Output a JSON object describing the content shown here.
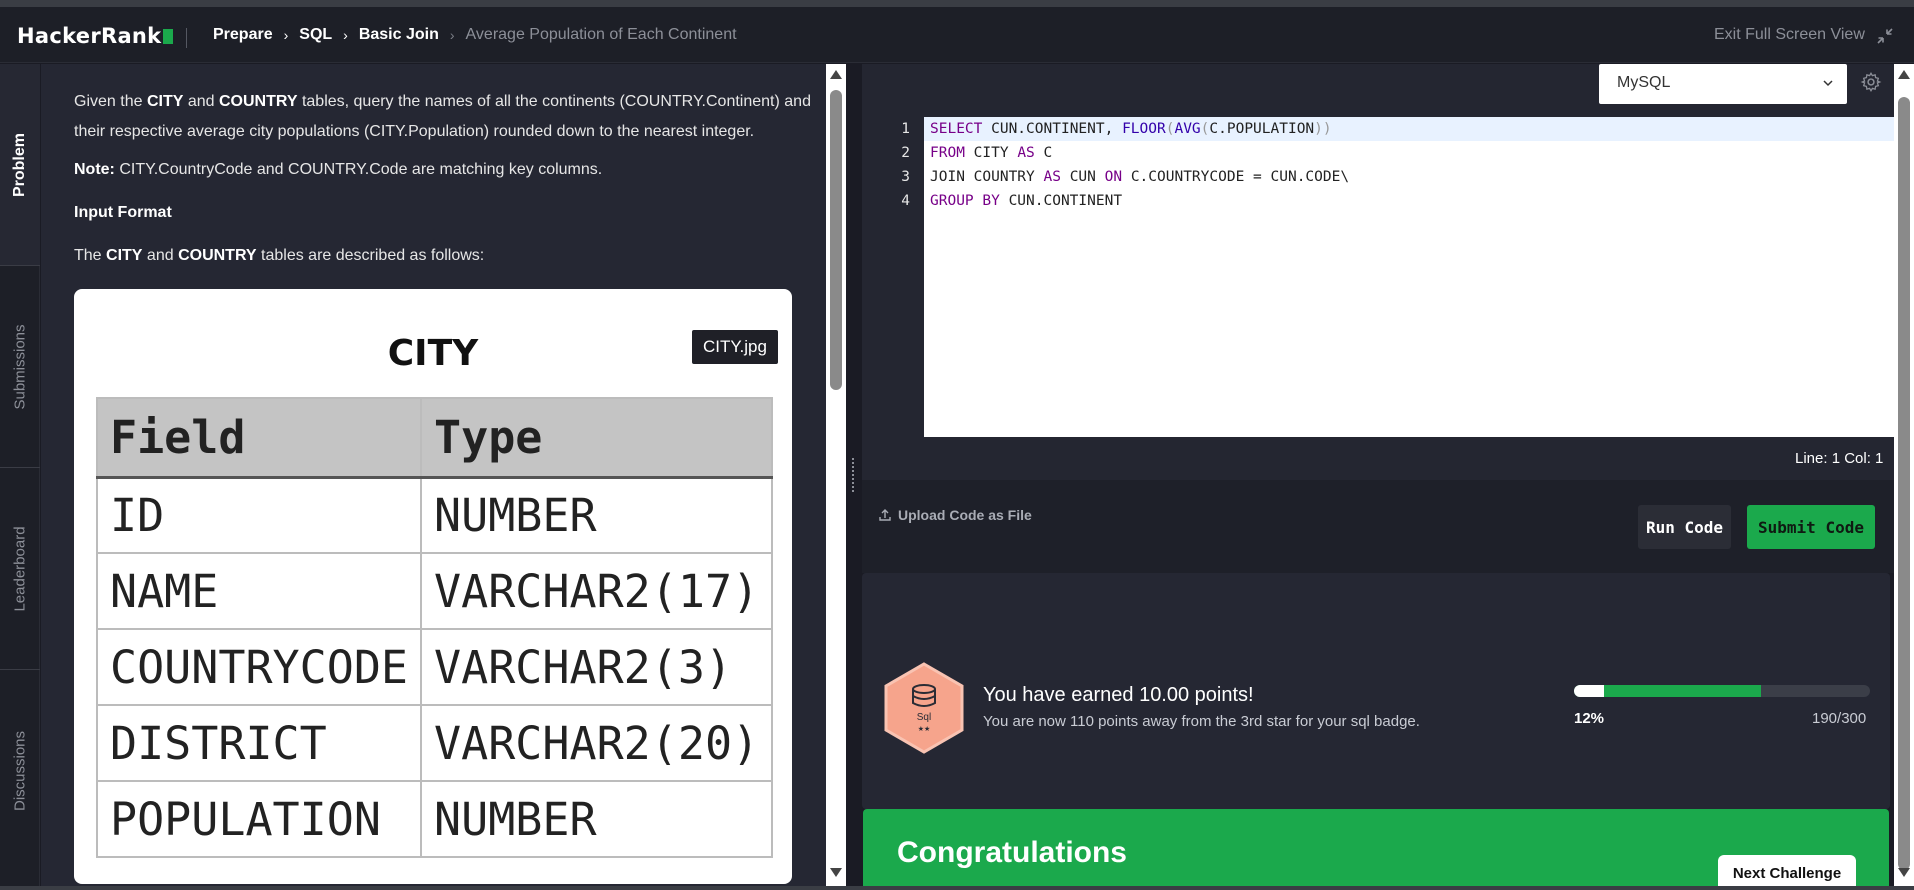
{
  "header": {
    "logo": "HackerRank",
    "breadcrumb": [
      "Prepare",
      "SQL",
      "Basic Join"
    ],
    "current_page": "Average Population of Each Continent",
    "exit_fullscreen": "Exit Full Screen View"
  },
  "side_tabs": [
    "Problem",
    "Submissions",
    "Leaderboard",
    "Discussions"
  ],
  "problem": {
    "intro_parts": [
      "Given the ",
      "CITY",
      " and ",
      "COUNTRY",
      " tables, query the names of all the continents (COUNTRY.Continent) and their respective average city populations (CITY.Population) rounded down to the nearest integer."
    ],
    "note_label": "Note:",
    "note_text": " CITY.CountryCode and COUNTRY.Code are matching key columns.",
    "input_format_heading": "Input Format",
    "desc_parts": [
      "The ",
      "CITY",
      " and ",
      "COUNTRY",
      " tables are described as follows:"
    ],
    "image": {
      "title": "CITY",
      "tooltip": "CITY.jpg",
      "headers": [
        "Field",
        "Type"
      ],
      "rows": [
        [
          "ID",
          "NUMBER"
        ],
        [
          "NAME",
          "VARCHAR2(17)"
        ],
        [
          "COUNTRYCODE",
          "VARCHAR2(3)"
        ],
        [
          "DISTRICT",
          "VARCHAR2(20)"
        ],
        [
          "POPULATION",
          "NUMBER"
        ]
      ]
    }
  },
  "editor": {
    "language": "MySQL",
    "line_numbers": [
      "1",
      "2",
      "3",
      "4"
    ],
    "status": "Line: 1 Col: 1",
    "upload_label": "Upload Code as File",
    "run_label": "Run Code",
    "submit_label": "Submit Code"
  },
  "result": {
    "badge_label": "Sql",
    "badge_stars": "★★",
    "earned": "You have earned 10.00 points!",
    "earned_sub": "You are now 110 points away from the 3rd star for your sql badge.",
    "progress_percent": "12%",
    "progress_fraction": "190/300",
    "progress_current": 190,
    "progress_total": 300,
    "progress_earned_prefix": 0.1,
    "congrats_title": "Congratulations",
    "next_label": "Next Challenge"
  },
  "colors": {
    "brand_green": "#1ba94c",
    "background": "#1a1b24",
    "panel": "#252733"
  }
}
